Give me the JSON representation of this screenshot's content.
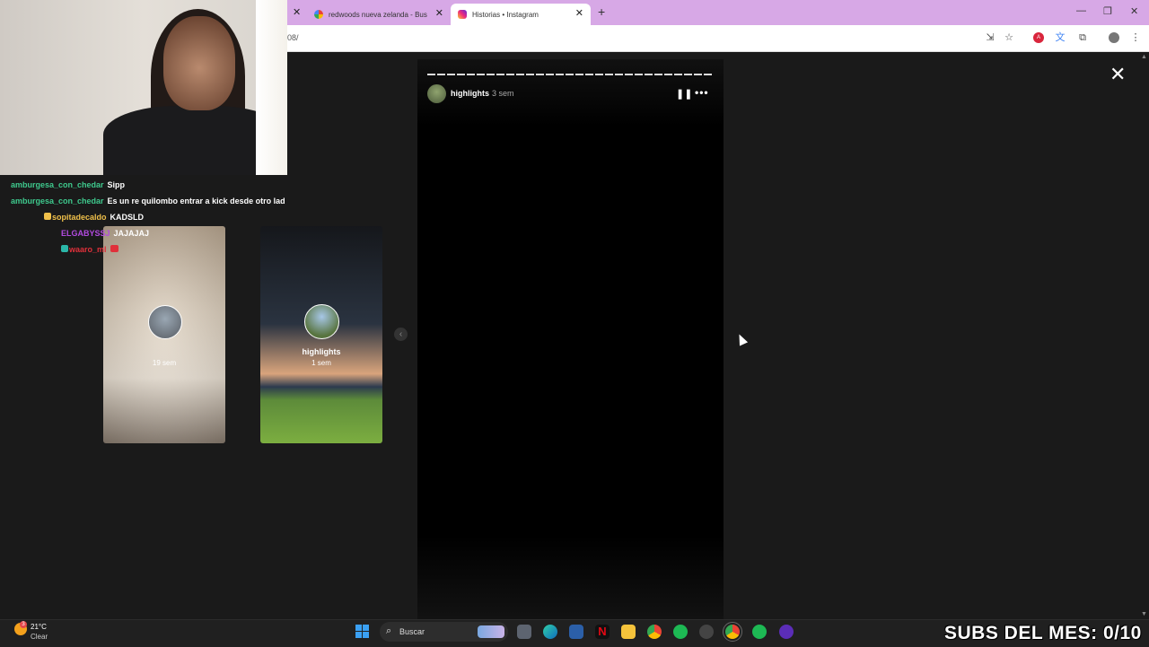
{
  "browser": {
    "tabs": [
      {
        "title": "redwoods nueva zelanda - Bus",
        "active": false
      },
      {
        "title": "Historias • Instagram",
        "active": true
      }
    ],
    "url": "08/"
  },
  "story": {
    "username": "highlights",
    "time": "3 sem"
  },
  "previews": [
    {
      "time": "19 sem"
    },
    {
      "name": "highlights",
      "time": "1 sem"
    }
  ],
  "chat": [
    {
      "user": "amburgesa_con_chedar",
      "message": "Sipp",
      "color": "#3ec98d"
    },
    {
      "user": "amburgesa_con_chedar",
      "message": "Es un re quilombo entrar a kick desde otro lad",
      "color": "#3ec98d"
    },
    {
      "user": "sopitadecaldo",
      "message": "KADSLD",
      "color": "#f0c04a"
    },
    {
      "user": "ELGABYSSJ",
      "message": "JAJAJAJ",
      "color": "#b24be0"
    },
    {
      "user": "waaro_ml",
      "message": "",
      "color": "#e0303a"
    }
  ],
  "taskbar": {
    "temperature": "21°C",
    "condition": "Clear",
    "weather_badge": "3",
    "search_label": "Buscar"
  },
  "overlay": {
    "subs_text": "SUBS DEL MES: 0/10"
  }
}
